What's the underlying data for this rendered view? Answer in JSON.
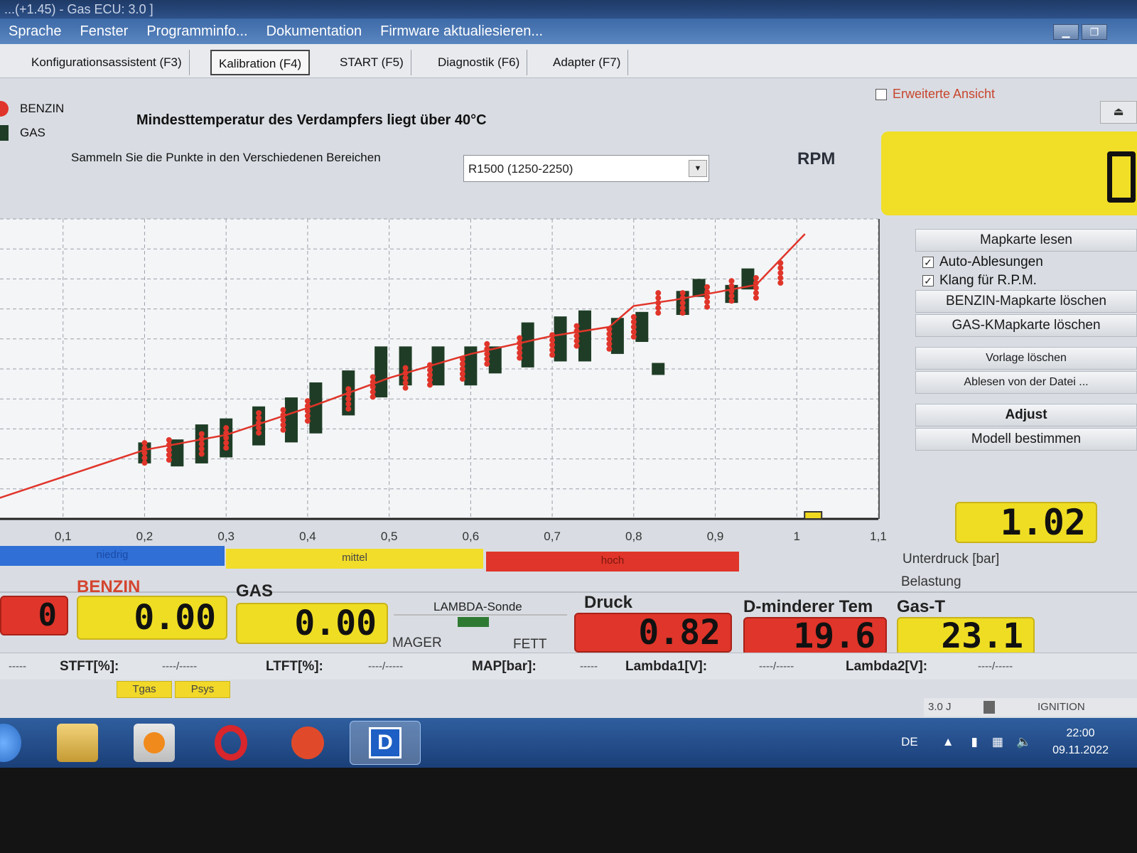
{
  "window": {
    "title": "...(+1.45) - Gas ECU: 3.0 ]"
  },
  "menu": [
    "Sprache",
    "Fenster",
    "Programminfo...",
    "Dokumentation",
    "Firmware aktualiesieren..."
  ],
  "tabs": [
    "Konfigurationsassistent (F3)",
    "Kalibration (F4)",
    "START (F5)",
    "Diagnostik (F6)",
    "Adapter (F7)"
  ],
  "active_tab": "Kalibration (F4)",
  "erweiterte_ansicht": "Erweiterte Ansicht",
  "legend": [
    {
      "label": "BENZIN",
      "color": "#e0352a"
    },
    {
      "label": "GAS",
      "color": "#1f3d26"
    }
  ],
  "heading": "Mindesttemperatur des Verdampfers liegt über 40°C",
  "subheading": "Sammeln Sie die Punkte in den Verschiedenen Bereichen",
  "rpm_select": {
    "value": "R1500 (1250-2250)"
  },
  "rpm_label": "RPM",
  "side": {
    "mapkarte_lesen": "Mapkarte lesen",
    "auto_ablesungen": "Auto-Ablesungen",
    "klang": "Klang für R.P.M.",
    "benzin_loeschen": "BENZIN-Mapkarte löschen",
    "gas_loeschen": "GAS-KMapkarte löschen",
    "vorlage_loeschen": "Vorlage löschen",
    "ablesen_datei": "Ablesen von der Datei ...",
    "adjust": "Adjust",
    "modell": "Modell bestimmen"
  },
  "unterdruck": {
    "value": "1.02",
    "label": "Unterdruck [bar]",
    "belastung": "Belastung"
  },
  "zones": [
    {
      "label": "niedrig",
      "color": "#2f6fd6"
    },
    {
      "label": "mittel",
      "color": "#f2dd2a"
    },
    {
      "label": "hoch",
      "color": "#e0352a"
    }
  ],
  "readouts": {
    "left_value": "0",
    "benzin_label": "BENZIN",
    "benzin_value": "0.00",
    "gas_label": "GAS",
    "gas_value": "0.00",
    "lambda_label": "LAMBDA-Sonde",
    "mager": "MAGER",
    "fett": "FETT",
    "druck_label": "Druck",
    "druck_value": "0.82",
    "dminderer_label": "D-minderer Tem",
    "dminderer_value": "19.6",
    "gast_label": "Gas-T",
    "gast_value": "23.1"
  },
  "status_row": {
    "dash": "-----",
    "stft": "STFT[%]:",
    "stft_val": "----/-----",
    "ltft": "LTFT[%]:",
    "ltft_val": "----/-----",
    "map": "MAP[bar]:",
    "map_val": "-----",
    "lambda1": "Lambda1[V]:",
    "lambda1_val": "----/-----",
    "lambda2": "Lambda2[V]:",
    "lambda2_val": "----/-----"
  },
  "tags": [
    "Tgas",
    "Psys"
  ],
  "bottom_status": {
    "version": "3.0 J",
    "ignition": "IGNITION"
  },
  "taskbar": {
    "lang": "DE",
    "time": "22:00",
    "date": "09.11.2022"
  },
  "chart_data": {
    "type": "scatter",
    "xlim": [
      0,
      1.1
    ],
    "ylim": [
      0,
      1
    ],
    "x_ticks": [
      "0,1",
      "0,2",
      "0,3",
      "0,4",
      "0,5",
      "0,6",
      "0,7",
      "0,8",
      "0,9",
      "1",
      "1,1"
    ],
    "grid": true,
    "benzin_curve": {
      "x": [
        0.0,
        0.2,
        0.3,
        0.4,
        0.5,
        0.6,
        0.7,
        0.77,
        0.8,
        0.85,
        0.95,
        1.01
      ],
      "y": [
        0.05,
        0.23,
        0.28,
        0.37,
        0.47,
        0.55,
        0.61,
        0.64,
        0.71,
        0.73,
        0.78,
        0.95
      ]
    },
    "gas_points": {
      "x": [
        0.2,
        0.24,
        0.27,
        0.3,
        0.34,
        0.38,
        0.41,
        0.45,
        0.49,
        0.52,
        0.56,
        0.6,
        0.63,
        0.67,
        0.71,
        0.74,
        0.78,
        0.81,
        0.83,
        0.86,
        0.88,
        0.92,
        0.94
      ],
      "y": [
        0.22,
        0.22,
        0.25,
        0.27,
        0.31,
        0.33,
        0.37,
        0.42,
        0.49,
        0.51,
        0.51,
        0.51,
        0.53,
        0.58,
        0.6,
        0.61,
        0.61,
        0.64,
        0.5,
        0.72,
        0.77,
        0.75,
        0.8
      ],
      "height": [
        0.07,
        0.09,
        0.13,
        0.13,
        0.13,
        0.15,
        0.17,
        0.15,
        0.17,
        0.13,
        0.13,
        0.13,
        0.09,
        0.15,
        0.15,
        0.17,
        0.12,
        0.1,
        0.04,
        0.08,
        0.06,
        0.06,
        0.07
      ]
    },
    "benzin_points": {
      "x": [
        0.2,
        0.23,
        0.27,
        0.3,
        0.34,
        0.37,
        0.4,
        0.45,
        0.48,
        0.52,
        0.55,
        0.59,
        0.62,
        0.66,
        0.7,
        0.73,
        0.77,
        0.8,
        0.83,
        0.86,
        0.89,
        0.92,
        0.95,
        0.98
      ],
      "y": [
        0.22,
        0.23,
        0.25,
        0.27,
        0.32,
        0.33,
        0.36,
        0.4,
        0.44,
        0.47,
        0.48,
        0.5,
        0.55,
        0.57,
        0.58,
        0.61,
        0.6,
        0.64,
        0.72,
        0.72,
        0.74,
        0.76,
        0.77,
        0.82
      ]
    },
    "marker_x": 1.02
  }
}
